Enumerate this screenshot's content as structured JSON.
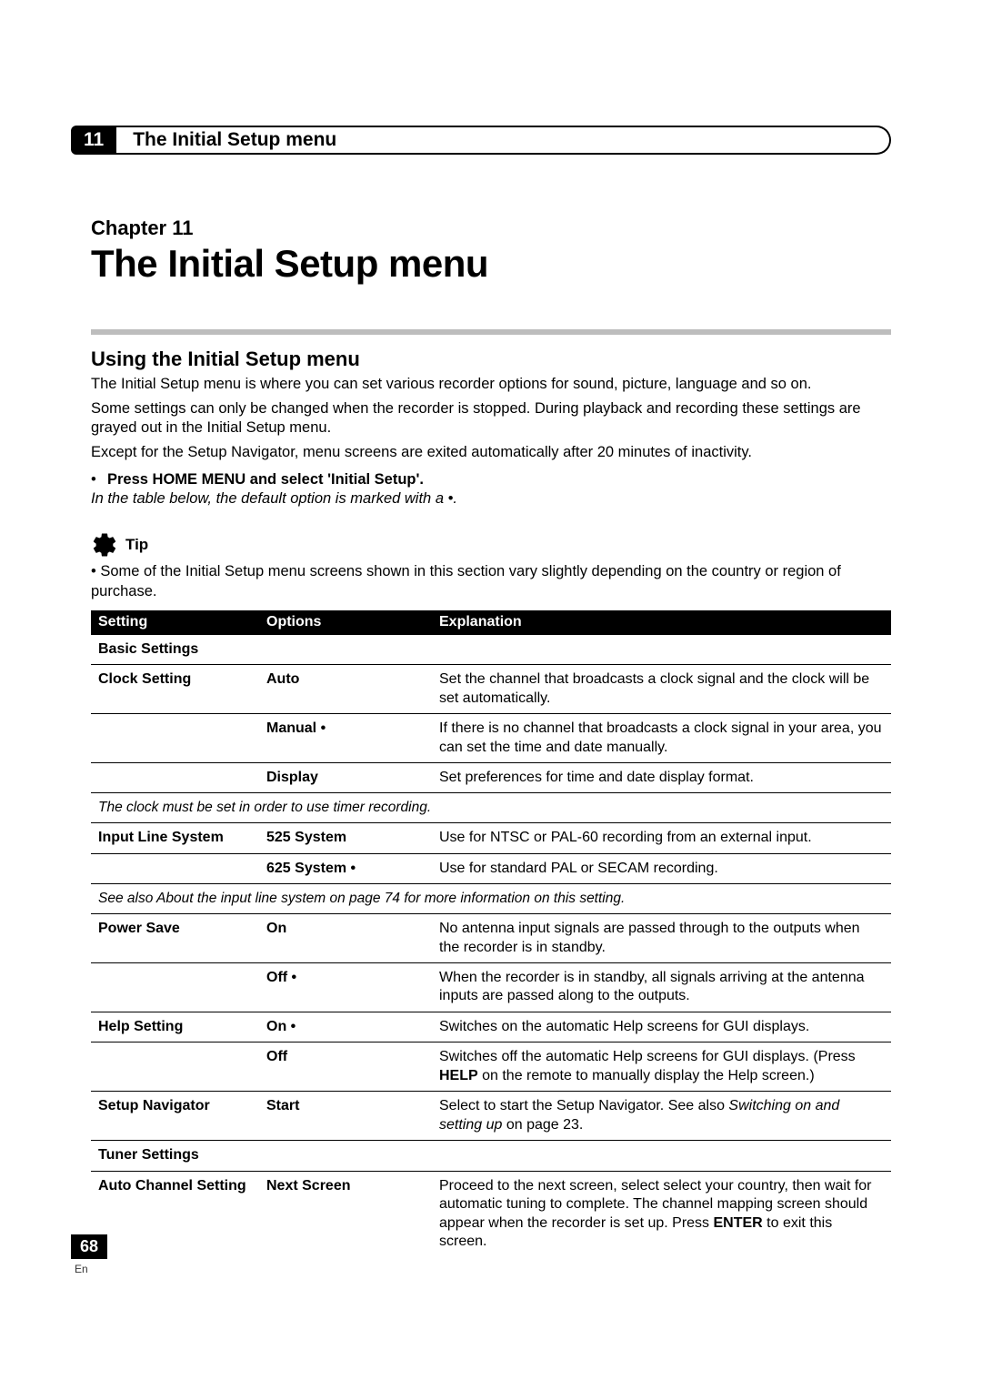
{
  "running_head": {
    "chapter_num": "11",
    "title": "The Initial Setup menu"
  },
  "chapter": {
    "label": "Chapter 11",
    "title": "The Initial Setup menu"
  },
  "section": {
    "heading": "Using the Initial Setup menu",
    "p1": "The Initial Setup menu is where you can set various recorder options for sound, picture, language and so on.",
    "p2": "Some settings can only be changed when the recorder is stopped. During playback and recording these settings are grayed out in the Initial Setup menu.",
    "p3": "Except for the Setup Navigator, menu screens are exited automatically after 20 minutes of inactivity.",
    "bullet_lead": "Press HOME MENU and select 'Initial Setup'.",
    "italic_note": "In the table below, the default option is marked with a •."
  },
  "tip": {
    "label": "Tip",
    "text": "• Some of the Initial Setup menu screens shown in this section vary slightly depending on the country or region of purchase."
  },
  "table": {
    "th_setting": "Setting",
    "th_options": "Options",
    "th_explanation": "Explanation",
    "group_basic": "Basic Settings",
    "clock_setting": "Clock Setting",
    "clock_auto": "Auto",
    "clock_auto_exp": "Set the channel that broadcasts a clock signal and the clock will be set automatically.",
    "clock_manual": "Manual •",
    "clock_manual_exp": "If there is no channel that broadcasts a clock signal in your area, you can set the time and date manually.",
    "clock_display": "Display",
    "clock_display_exp": "Set preferences for time and date display format.",
    "clock_footnote": "The clock must be set in order to use timer recording.",
    "input_line": "Input Line System",
    "ils_525": "525 System",
    "ils_525_exp": "Use for NTSC or PAL-60 recording from an external input.",
    "ils_625": "625 System •",
    "ils_625_exp": "Use for standard PAL or SECAM recording.",
    "ils_footnote": "See also About the input line system on page 74 for more information on this setting.",
    "power_save": "Power Save",
    "ps_on": "On",
    "ps_on_exp": "No antenna input signals are passed through to the outputs when the recorder is in standby.",
    "ps_off": "Off •",
    "ps_off_exp": "When the recorder is in standby, all signals arriving at the antenna inputs are passed along to the outputs.",
    "help_setting": "Help Setting",
    "help_on": "On •",
    "help_on_exp": "Switches on the automatic Help screens for GUI displays.",
    "help_off": "Off",
    "help_off_pre": "Switches off the automatic Help screens for GUI displays. (Press ",
    "help_off_bold": "HELP",
    "help_off_post": " on the remote to manually display the Help screen.)",
    "setup_nav": "Setup Navigator",
    "sn_start": "Start",
    "sn_exp_pre": "Select to start the Setup Navigator. See also ",
    "sn_exp_i": "Switching on and setting up",
    "sn_exp_post": " on page 23.",
    "group_tuner": "Tuner Settings",
    "acs": "Auto Channel Setting",
    "acs_next": "Next Screen",
    "acs_pre": "Proceed to the next screen, select select your country, then wait for automatic tuning to complete. The channel mapping screen should appear when the recorder is set up. Press ",
    "acs_bold": "ENTER",
    "acs_post": " to exit this screen."
  },
  "page": {
    "number": "68",
    "lang": "En"
  }
}
